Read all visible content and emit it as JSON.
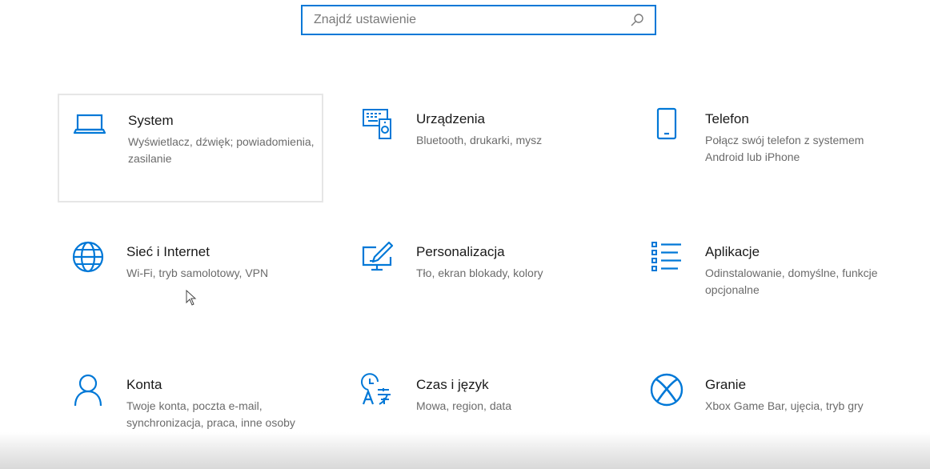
{
  "search": {
    "placeholder": "Znajdź ustawienie",
    "icon": "search-icon"
  },
  "accent_color": "#0078d7",
  "categories": [
    {
      "title": "System",
      "description": "Wyświetlacz, dźwięk; powiadomienia, zasilanie",
      "icon": "laptop-icon"
    },
    {
      "title": "Urządzenia",
      "description": "Bluetooth, drukarki, mysz",
      "icon": "devices-icon"
    },
    {
      "title": "Telefon",
      "description": "Połącz swój telefon z systemem Android lub iPhone",
      "icon": "phone-icon"
    },
    {
      "title": "Sieć i Internet",
      "description": "Wi-Fi, tryb samolotowy, VPN",
      "icon": "globe-icon"
    },
    {
      "title": "Personalizacja",
      "description": "Tło, ekran blokady, kolory",
      "icon": "personalization-icon"
    },
    {
      "title": "Aplikacje",
      "description": "Odinstalowanie, domyślne, funkcje opcjonalne",
      "icon": "apps-list-icon"
    },
    {
      "title": "Konta",
      "description": "Twoje konta, poczta e-mail, synchronizacja, praca, inne osoby",
      "icon": "person-icon"
    },
    {
      "title": "Czas i język",
      "description": "Mowa, region, data",
      "icon": "time-language-icon"
    },
    {
      "title": "Granie",
      "description": "Xbox Game Bar, ujęcia, tryb gry",
      "icon": "xbox-icon"
    }
  ]
}
